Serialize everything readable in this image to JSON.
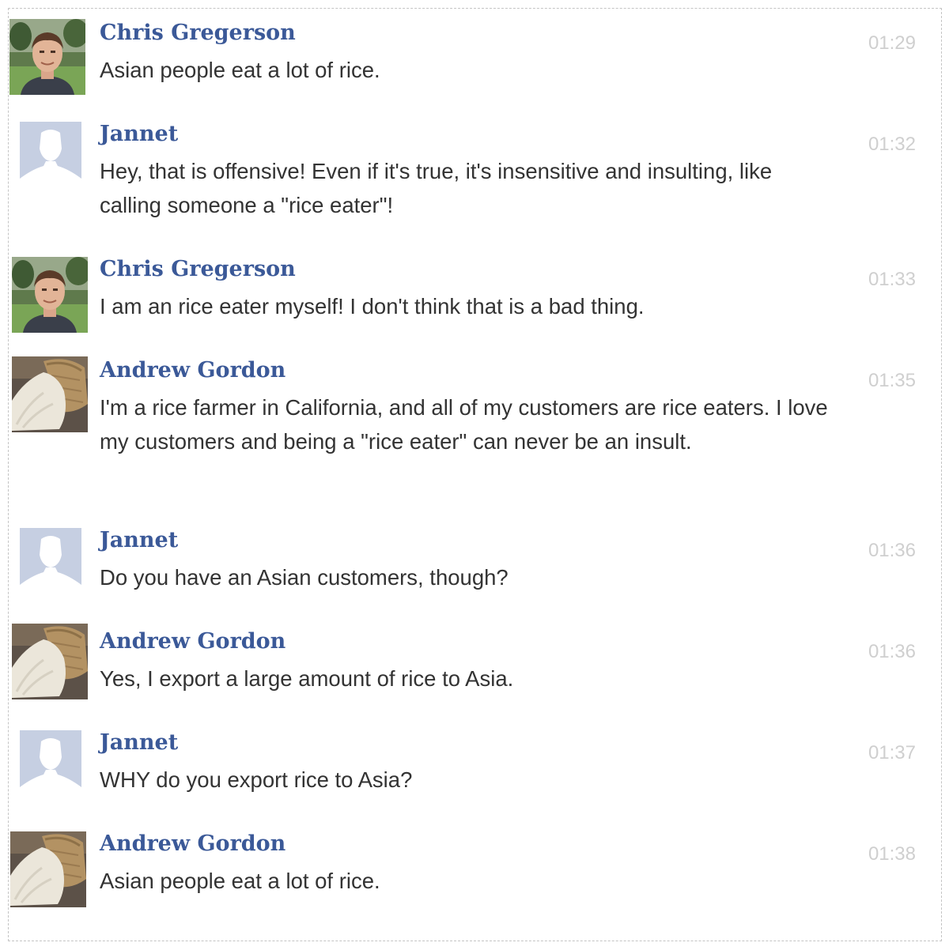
{
  "messages": [
    {
      "sender": "Chris Gregerson",
      "text": "Asian people eat a lot of rice.",
      "time": "01:29",
      "avatar": "chris-photo"
    },
    {
      "sender": "Jannet",
      "text": "Hey, that is offensive! Even if it's true, it's insensitive and insulting, like calling someone a \"rice eater\"!",
      "time": "01:32",
      "avatar": "default-silhouette"
    },
    {
      "sender": "Chris Gregerson",
      "text": "I am an rice eater myself! I don't think that is a bad thing.",
      "time": "01:33",
      "avatar": "chris-photo"
    },
    {
      "sender": "Andrew Gordon",
      "text": "I'm a rice farmer in California, and all of my customers are rice eaters. I love my customers and being a \"rice eater\" can never be an insult.",
      "time": "01:35",
      "avatar": "rice-sack-photo"
    },
    {
      "sender": "Jannet",
      "text": "Do you have an Asian customers, though?",
      "time": "01:36",
      "avatar": "default-silhouette"
    },
    {
      "sender": "Andrew Gordon",
      "text": "Yes, I export a large amount of rice to Asia.",
      "time": "01:36",
      "avatar": "rice-sack-photo"
    },
    {
      "sender": "Jannet",
      "text": "WHY do you export rice to Asia?",
      "time": "01:37",
      "avatar": "default-silhouette"
    },
    {
      "sender": "Andrew Gordon",
      "text": "Asian people eat a lot of rice.",
      "time": "01:38",
      "avatar": "rice-sack-photo"
    }
  ],
  "colors": {
    "sender_name": "#3b5998",
    "message_text": "#333333",
    "timestamp": "#cfcfcf",
    "silhouette_bg": "#c6cfe2"
  }
}
